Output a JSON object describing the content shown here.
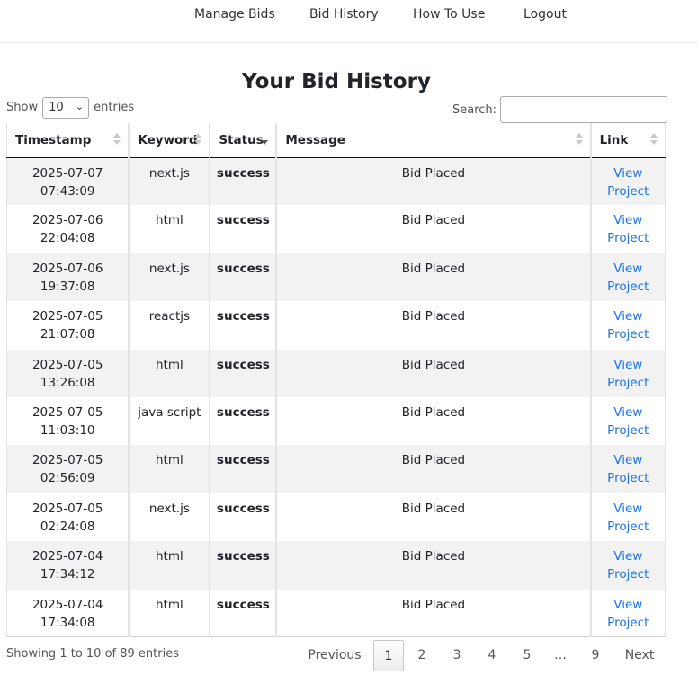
{
  "nav": {
    "items": [
      "Manage Bids",
      "Bid History",
      "How To Use",
      "Logout"
    ]
  },
  "page": {
    "title": "Your Bid History"
  },
  "controls": {
    "show_label": "Show",
    "entries_label": "entries",
    "page_length": "10",
    "search_label": "Search:",
    "search_value": ""
  },
  "table": {
    "columns": [
      "Timestamp",
      "Keyword",
      "Status",
      "Message",
      "Link"
    ],
    "rows": [
      {
        "date": "2025-07-07",
        "time": "07:43:09",
        "keyword": "next.js",
        "status": "success",
        "message": "Bid Placed",
        "link1": "View",
        "link2": "Project"
      },
      {
        "date": "2025-07-06",
        "time": "22:04:08",
        "keyword": "html",
        "status": "success",
        "message": "Bid Placed",
        "link1": "View",
        "link2": "Project"
      },
      {
        "date": "2025-07-06",
        "time": "19:37:08",
        "keyword": "next.js",
        "status": "success",
        "message": "Bid Placed",
        "link1": "View",
        "link2": "Project"
      },
      {
        "date": "2025-07-05",
        "time": "21:07:08",
        "keyword": "reactjs",
        "status": "success",
        "message": "Bid Placed",
        "link1": "View",
        "link2": "Project"
      },
      {
        "date": "2025-07-05",
        "time": "13:26:08",
        "keyword": "html",
        "status": "success",
        "message": "Bid Placed",
        "link1": "View",
        "link2": "Project"
      },
      {
        "date": "2025-07-05",
        "time": "11:03:10",
        "keyword": "java script",
        "status": "success",
        "message": "Bid Placed",
        "link1": "View",
        "link2": "Project"
      },
      {
        "date": "2025-07-05",
        "time": "02:56:09",
        "keyword": "html",
        "status": "success",
        "message": "Bid Placed",
        "link1": "View",
        "link2": "Project"
      },
      {
        "date": "2025-07-05",
        "time": "02:24:08",
        "keyword": "next.js",
        "status": "success",
        "message": "Bid Placed",
        "link1": "View",
        "link2": "Project"
      },
      {
        "date": "2025-07-04",
        "time": "17:34:12",
        "keyword": "html",
        "status": "success",
        "message": "Bid Placed",
        "link1": "View",
        "link2": "Project"
      },
      {
        "date": "2025-07-04",
        "time": "17:34:08",
        "keyword": "html",
        "status": "success",
        "message": "Bid Placed",
        "link1": "View",
        "link2": "Project"
      }
    ]
  },
  "footer": {
    "info": "Showing 1 to 10 of 89 entries",
    "pagination": [
      "Previous",
      "1",
      "2",
      "3",
      "4",
      "5",
      "…",
      "9",
      "Next"
    ],
    "current_page": "1"
  },
  "colors": {
    "status_success": "#198754",
    "link": "#1a73e8",
    "row_stripe": "#f2f2f2"
  },
  "icons": {
    "sort": "sort-arrows-icon",
    "dropdown": "chevron-down-icon"
  }
}
